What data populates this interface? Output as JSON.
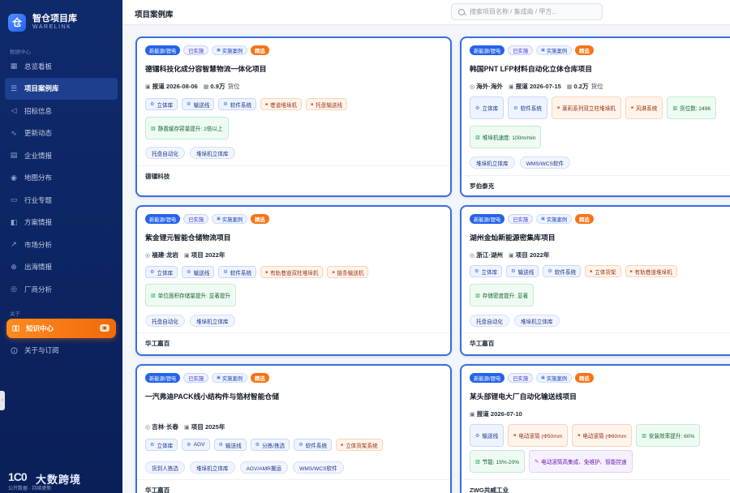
{
  "brand": {
    "name": "智仓项目库",
    "sub": "WARELINK",
    "logo_char": "仓"
  },
  "sidebar": {
    "section_data": "数据中心",
    "items": [
      {
        "label": "总览看板",
        "icon": "dashboard-icon"
      },
      {
        "label": "项目案例库",
        "icon": "database-icon",
        "active": true
      },
      {
        "label": "招标信息",
        "icon": "megaphone-icon"
      },
      {
        "label": "更新动态",
        "icon": "activity-icon"
      },
      {
        "label": "企业情报",
        "icon": "building-icon"
      },
      {
        "label": "地图分布",
        "icon": "map-pin-icon"
      },
      {
        "label": "行业专题",
        "icon": "folder-icon"
      },
      {
        "label": "方案情报",
        "icon": "layers-icon"
      },
      {
        "label": "市场分析",
        "icon": "trend-icon"
      },
      {
        "label": "出海情报",
        "icon": "globe-icon"
      },
      {
        "label": "厂商分析",
        "icon": "target-icon"
      }
    ],
    "section_about": "关于",
    "knowledge": {
      "label": "知识中心",
      "icon": "book-icon",
      "badge": "▣"
    },
    "about_item": {
      "label": "关于与订阅",
      "icon": "info-icon"
    },
    "footer_mark": "1C0",
    "footer_name": "大数跨境",
    "footer_slogan": "公开数据 · 持续更新"
  },
  "topbar": {
    "title": "项目案例库",
    "search_placeholder": "搜索项目名称 / 集成商 / 甲方..."
  },
  "cards": [
    {
      "tags": [
        "新能源/锂电",
        "已实施",
        "实施案例",
        "精选"
      ],
      "title": "德镭科技化成分容智慧物流一体化项目",
      "meta": [
        {
          "icon": "▣",
          "text": "报道 2026-08-06"
        },
        {
          "icon": "▦",
          "text": "0.9万",
          "suffix": "货位"
        }
      ],
      "chips": [
        {
          "text": "立体库",
          "type": "blue"
        },
        {
          "text": "输送线",
          "type": "blue"
        },
        {
          "text": "软件系统",
          "type": "blue"
        },
        {
          "text": "巷道堆垛机",
          "type": "orange"
        },
        {
          "text": "托盘输送线",
          "type": "orange"
        }
      ],
      "chips2": [
        {
          "text": "静置缓存容量提升: 2倍以上",
          "type": "green"
        }
      ],
      "keywords": [
        "托盘自动化",
        "堆垛机立体库"
      ],
      "company": "德镭科技"
    },
    {
      "tags": [
        "新能源/锂电",
        "已实施",
        "实施案例",
        "精选"
      ],
      "title": "韩国PNT LFP材料自动化立体仓库项目",
      "meta": [
        {
          "icon": "◎",
          "text": "海外·海外"
        },
        {
          "icon": "▣",
          "text": "报道 2026-07-15"
        },
        {
          "icon": "▦",
          "text": "0.2万",
          "suffix": "货位"
        }
      ],
      "chips": [
        {
          "text": "立体库",
          "type": "blue"
        },
        {
          "text": "软件系统",
          "type": "blue"
        },
        {
          "text": "莱莉系列双立柱堆垛机",
          "type": "orange"
        },
        {
          "text": "风淋系统",
          "type": "orange"
        },
        {
          "text": "货位数: 2496",
          "type": "green"
        }
      ],
      "chips2": [
        {
          "text": "堆垛机速度: 100m/min",
          "type": "green"
        }
      ],
      "keywords": [
        "堆垛机立体库",
        "WMS/WCS软件"
      ],
      "company": "罗伯泰克"
    },
    {
      "tags": [
        "新能源/锂电",
        "已实施",
        "实施案例",
        "精选"
      ],
      "title": "紫金锂元智能仓储物流项目",
      "meta": [
        {
          "icon": "◎",
          "text": "福建·龙岩"
        },
        {
          "icon": "▣",
          "text": "项目 2022年"
        }
      ],
      "chips": [
        {
          "text": "立体库",
          "type": "blue"
        },
        {
          "text": "输送线",
          "type": "blue"
        },
        {
          "text": "软件系统",
          "type": "blue"
        },
        {
          "text": "有轨巷道双柱堆垛机",
          "type": "orange"
        },
        {
          "text": "链条输送机",
          "type": "orange"
        }
      ],
      "chips2": [
        {
          "text": "单位面积存储量提升: 显著提升",
          "type": "green"
        }
      ],
      "keywords": [
        "托盘自动化",
        "堆垛机立体库"
      ],
      "company": "华工嘉百"
    },
    {
      "tags": [
        "新能源/锂电",
        "已实施",
        "实施案例",
        "精选"
      ],
      "title": "湖州金灿新能源密集库项目",
      "meta": [
        {
          "icon": "◎",
          "text": "浙江·湖州"
        },
        {
          "icon": "▣",
          "text": "项目 2022年"
        }
      ],
      "chips": [
        {
          "text": "立体库",
          "type": "blue"
        },
        {
          "text": "输送线",
          "type": "blue"
        },
        {
          "text": "软件系统",
          "type": "blue"
        },
        {
          "text": "立体货架",
          "type": "orange"
        },
        {
          "text": "有轨巷道堆垛机",
          "type": "orange"
        }
      ],
      "chips2": [
        {
          "text": "存储密度提升: 显著",
          "type": "green"
        }
      ],
      "keywords": [
        "托盘自动化",
        "堆垛机立体库"
      ],
      "company": "华工嘉百"
    },
    {
      "tags": [
        "新能源/锂电",
        "已实施",
        "实施案例",
        "精选"
      ],
      "title": "一汽弗迪PACK线小结构件与箔材智能仓储",
      "meta": [
        {
          "icon": "◎",
          "text": "吉林·长春"
        },
        {
          "icon": "▣",
          "text": "项目 2025年"
        }
      ],
      "chips": [
        {
          "text": "立体库",
          "type": "blue"
        },
        {
          "text": "AGV",
          "type": "blue"
        },
        {
          "text": "输送线",
          "type": "blue"
        },
        {
          "text": "分拣/拣选",
          "type": "blue"
        },
        {
          "text": "软件系统",
          "type": "blue"
        },
        {
          "text": "立体货架系统",
          "type": "orange"
        }
      ],
      "chips2": [],
      "keywords": [
        "货到人拣选",
        "堆垛机立体库",
        "AGV/AMR搬运",
        "WMS/WCS软件"
      ],
      "company": "华工嘉百"
    },
    {
      "tags": [
        "新能源/锂电",
        "已实施",
        "实施案例",
        "精选"
      ],
      "title": "某头部锂电大厂自动化输送线项目",
      "meta": [
        {
          "icon": "▣",
          "text": "报道 2026-07-10"
        }
      ],
      "chips": [
        {
          "text": "输送线",
          "type": "blue"
        },
        {
          "text": "电动滚筒 (Φ50mm",
          "type": "orange"
        },
        {
          "text": "电动滚筒 (Φ60mm",
          "type": "orange"
        },
        {
          "text": "安装效率提升: 60%",
          "type": "green"
        }
      ],
      "chips2": [
        {
          "text": "节能: 15%-20%",
          "type": "green"
        },
        {
          "text": "电动滚筒高集成、免维护、智能控速",
          "type": "purple"
        }
      ],
      "keywords": [],
      "company": "ZWG共威工业"
    }
  ]
}
